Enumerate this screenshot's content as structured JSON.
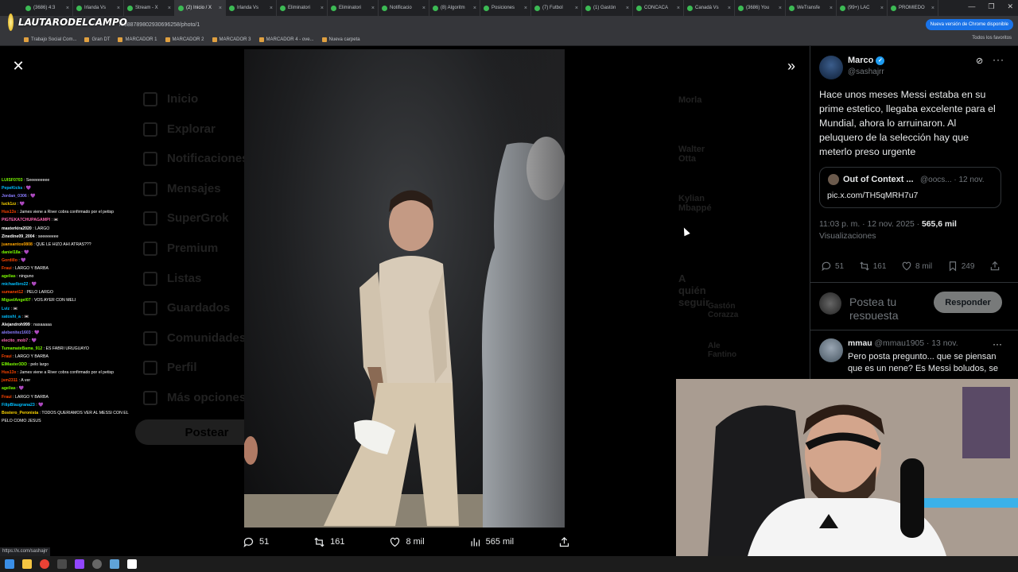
{
  "browser": {
    "tabs": [
      {
        "label": "(3686) 4:3"
      },
      {
        "label": "Irlanda Vs"
      },
      {
        "label": "Stream - X"
      },
      {
        "label": "(2) Inicio / X",
        "active": true
      },
      {
        "label": "Irlanda Vs"
      },
      {
        "label": "Eliminatori"
      },
      {
        "label": "Eliminatori"
      },
      {
        "label": "Notificacio"
      },
      {
        "label": "(8) Algoritm"
      },
      {
        "label": "Posiciones"
      },
      {
        "label": "(7) Futbol"
      },
      {
        "label": "(1) Gastón"
      },
      {
        "label": "CONCACA"
      },
      {
        "label": "Canadá Vs"
      },
      {
        "label": "(3686) You"
      },
      {
        "label": "WeTransfe"
      },
      {
        "label": "(99+) LAC"
      },
      {
        "label": "PROMIEDO"
      }
    ],
    "url": "/198878980293069​6258/photo/1",
    "update_chip": "Nueva versión de Chrome disponible",
    "bookmarks": [
      "Trabajo Social Com...",
      "Gran DT",
      "MARCADOR 1",
      "MARCADOR 2",
      "MARCADOR 3",
      "MARCADOR 4 - ove...",
      "Nueva carpeta"
    ],
    "all_bookmarks": "Todos los favoritos",
    "status_url": "https://x.com/sashajrr"
  },
  "overlay_logo": "LAUTARODELCAMPO",
  "background_feed": {
    "nav": [
      "Inicio",
      "Explorar",
      "Notificaciones",
      "Mensajes",
      "SuperGrok",
      "Premium",
      "Listas",
      "Guardados",
      "Comunidades",
      "Perfil",
      "Más opciones"
    ],
    "post_button": "Postear",
    "right_items": [
      "Morla",
      "Walter Otta",
      "Kylian Mbappé"
    ],
    "who_to_follow": "A quién seguir",
    "follow_names": [
      "Gastón Corazza",
      "Ale Fantino"
    ]
  },
  "photo_actions": {
    "replies": "51",
    "reposts": "161",
    "likes": "8 mil",
    "views": "565 mil"
  },
  "chat": [
    {
      "user": "LUISF0703",
      "msg": "Seeeeeeeee",
      "color": "#7cfc00"
    },
    {
      "user": "PepeKicks",
      "msg": "💜",
      "color": "#00bfff"
    },
    {
      "user": "Jordan_0306",
      "msg": "💜",
      "color": "#8a7cff"
    },
    {
      "user": "luck1zz",
      "msg": "💜",
      "color": "#ffd700"
    },
    {
      "user": "Hus13x",
      "msg": "James viene a River cobra confirmado por el petisp",
      "color": "#ff4500"
    },
    {
      "user": "PIGTEKA7CHUPAGAMPI",
      "msg": "📼",
      "color": "#ff69b4"
    },
    {
      "user": "masterkira2020",
      "msg": "LARGO",
      "color": "#ffffff"
    },
    {
      "user": "Zinedine09_2004",
      "msg": "seeeeeeee",
      "color": "#ffffff"
    },
    {
      "user": "juansantos0808",
      "msg": "QUE LE HIZO AHI ATRAS???",
      "color": "#ffa500"
    },
    {
      "user": "daniel18a",
      "msg": "💜",
      "color": "#7cfc00"
    },
    {
      "user": "Gordillo",
      "msg": "💜",
      "color": "#ff4500"
    },
    {
      "user": "Fraui",
      "msg": "LARGO Y BARBA",
      "color": "#ff4500"
    },
    {
      "user": "agelias",
      "msg": "ninguno",
      "color": "#7cfc00"
    },
    {
      "user": "michaelbro22",
      "msg": "💜",
      "color": "#00bfff"
    },
    {
      "user": "sumanet12",
      "msg": "PELO LARGO",
      "color": "#ff4500"
    },
    {
      "user": "MiguelAngel07",
      "msg": "VOS AYER CON MELI",
      "color": "#7cfc00"
    },
    {
      "user": "Lviz",
      "msg": "📼",
      "color": "#00bfff"
    },
    {
      "user": "satoshi_a",
      "msg": "📼",
      "color": "#00bfff"
    },
    {
      "user": "Alejandroh999",
      "msg": "nasaaaaa",
      "color": "#ffffff"
    },
    {
      "user": "alebenitez1603",
      "msg": "💜",
      "color": "#8a7cff"
    },
    {
      "user": "elecito_mob7",
      "msg": "💜",
      "color": "#ff69b4"
    },
    {
      "user": "TumamateBama_912",
      "msg": "ES FABRI URUGUAYO",
      "color": "#7cfc00"
    },
    {
      "user": "Fraui",
      "msg": "LARGO Y BARBA",
      "color": "#ff4500"
    },
    {
      "user": "ElMaster3DD",
      "msg": "pelo largo",
      "color": "#7cfc00"
    },
    {
      "user": "Hus13x",
      "msg": "James viene a River cobra confirmado por el petisp",
      "color": "#ff4500"
    },
    {
      "user": "jsm2311",
      "msg": "A ver",
      "color": "#ff4500"
    },
    {
      "user": "agelias",
      "msg": "💜",
      "color": "#7cfc00"
    },
    {
      "user": "Fraui",
      "msg": "LARGO Y BARBA",
      "color": "#ff4500"
    },
    {
      "user": "FilipBlaugrana23",
      "msg": "💜",
      "color": "#00bfff"
    },
    {
      "user": "Bostero_Peronista",
      "msg": "TODOS QUERIAMOS VER AL MESSI CON EL PELO COMO JESUS",
      "color": "#ffd700"
    }
  ],
  "tweet": {
    "author_name": "Marco",
    "author_handle": "@sashajrr",
    "text": "Hace unos meses Messi estaba en su prime estetico, llegaba excelente para el Mundial, ahora lo arruinaron. Al peluquero de la selección hay que meterlo preso urgente",
    "quote_name": "Out of Context ...",
    "quote_meta": "@oocs... · 12 nov.",
    "quote_link": "pic.x.com/TH5qMRH7u7",
    "time": "11:03 p. m. · 12 nov. 2025 · ",
    "views_count": "565,6 mil",
    "views_label": "Visualizaciones",
    "replies": "51",
    "reposts": "161",
    "likes": "8 mil",
    "bookmarks": "249"
  },
  "reply_box": {
    "placeholder": "Postea tu respuesta",
    "button": "Responder"
  },
  "reply1": {
    "name": "mmau",
    "meta": "@mmau1905 · 13 nov.",
    "text": "Pero posta pregunto... que se piensan que es un nene? Es Messi boludos, se"
  },
  "colors": {
    "accent": "#1d9bf0",
    "background": "#000000",
    "muted": "#71767b",
    "reply_button": "#787a7a"
  }
}
